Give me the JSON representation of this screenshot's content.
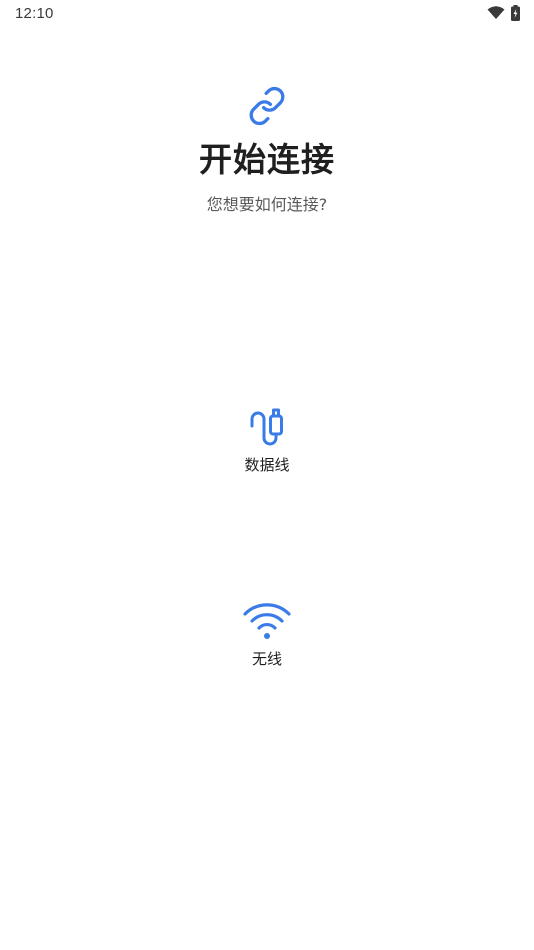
{
  "status_bar": {
    "time": "12:10",
    "icons": [
      "wifi-icon",
      "battery-charging-icon"
    ]
  },
  "header": {
    "icon": "link-icon",
    "title": "开始连接",
    "subtitle": "您想要如何连接?"
  },
  "options": [
    {
      "icon": "usb-cable-icon",
      "label": "数据线"
    },
    {
      "icon": "wifi-icon",
      "label": "无线"
    }
  ],
  "colors": {
    "accent": "#3b7be8",
    "text_primary": "#1f1f1f",
    "text_secondary": "#5a5a5a",
    "background": "#ffffff"
  }
}
